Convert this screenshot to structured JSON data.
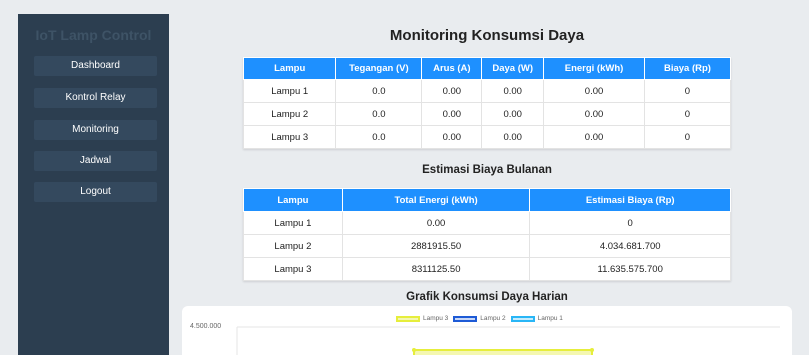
{
  "sidebar": {
    "brand": "IoT Lamp Control",
    "items": [
      {
        "label": "Dashboard"
      },
      {
        "label": "Kontrol Relay"
      },
      {
        "label": "Monitoring"
      },
      {
        "label": "Jadwal"
      },
      {
        "label": "Logout"
      }
    ]
  },
  "monitoring": {
    "title": "Monitoring Konsumsi Daya",
    "headers": [
      "Lampu",
      "Tegangan (V)",
      "Arus (A)",
      "Daya (W)",
      "Energi (kWh)",
      "Biaya (Rp)"
    ],
    "rows": [
      [
        "Lampu 1",
        "0.0",
        "0.00",
        "0.00",
        "0.00",
        "0"
      ],
      [
        "Lampu 2",
        "0.0",
        "0.00",
        "0.00",
        "0.00",
        "0"
      ],
      [
        "Lampu 3",
        "0.0",
        "0.00",
        "0.00",
        "0.00",
        "0"
      ]
    ]
  },
  "estimasi": {
    "title": "Estimasi Biaya Bulanan",
    "headers": [
      "Lampu",
      "Total Energi (kWh)",
      "Estimasi Biaya (Rp)"
    ],
    "rows": [
      [
        "Lampu 1",
        "0.00",
        "0"
      ],
      [
        "Lampu 2",
        "2881915.50",
        "4.034.681.700"
      ],
      [
        "Lampu 3",
        "8311125.50",
        "11.635.575.700"
      ]
    ]
  },
  "chart": {
    "title": "Grafik Konsumsi Daya Harian"
  },
  "chart_data": {
    "type": "line",
    "title": "Grafik Konsumsi Daya Harian",
    "legend_placement": "top",
    "series": [
      {
        "name": "Lampu 3",
        "color": "#e6ee3c"
      },
      {
        "name": "Lampu 2",
        "color": "#1e5bd6"
      },
      {
        "name": "Lampu 1",
        "color": "#29b6f6"
      }
    ],
    "y_tick_labels": [
      "4.500.000"
    ],
    "note_visible": "chart partially visible; only top gridline and upper edge of Lampu 3 fill are shown"
  },
  "colors": {
    "sidebar_bg": "#2c3e50",
    "nav_item_bg": "#34495e",
    "table_header": "#1e90ff",
    "page_bg": "#e9ecef"
  }
}
